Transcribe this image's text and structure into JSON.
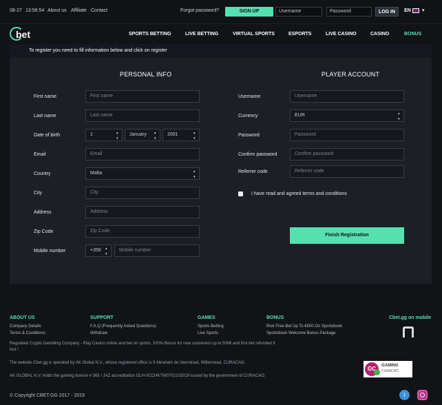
{
  "topbar": {
    "date": "08-27",
    "time": "13:56:54",
    "links": [
      "About us",
      "Affiliate",
      "Contact"
    ],
    "forgot": "Forgot password?",
    "signup": "SIGN UP",
    "username_ph": "Username",
    "password_ph": "Password",
    "login": "LOG IN",
    "lang": "EN"
  },
  "brand": {
    "logo_text": "bet"
  },
  "nav": [
    "SPORTS BETTING",
    "LIVE BETTING",
    "VIRTUAL SPORTS",
    "ESPORTS",
    "LIVE CASINO",
    "CASINO",
    "BONUS"
  ],
  "panel": {
    "notice": "To register you need to fill information below and click on register",
    "personal_title": "PERSONAL INFO",
    "account_title": "PLAYER ACCOUNT"
  },
  "personal": {
    "first_name": {
      "label": "First name",
      "placeholder": "First name"
    },
    "last_name": {
      "label": "Last name",
      "placeholder": "Last name"
    },
    "dob": {
      "label": "Date of birth",
      "day": "1",
      "month": "January",
      "year": "2001"
    },
    "email": {
      "label": "Email",
      "placeholder": "Email"
    },
    "country": {
      "label": "Country",
      "value": "Malta"
    },
    "city": {
      "label": "City",
      "placeholder": "City"
    },
    "address": {
      "label": "Address",
      "placeholder": "Address"
    },
    "zip": {
      "label": "Zip Code",
      "placeholder": "Zip Code"
    },
    "mobile": {
      "label": "Mobile number",
      "prefix": "+356",
      "placeholder": "Mobile number"
    }
  },
  "account": {
    "username": {
      "label": "Username",
      "placeholder": "Username"
    },
    "currency": {
      "label": "Currency",
      "value": "EUR"
    },
    "password": {
      "label": "Password",
      "placeholder": "Password"
    },
    "confirm": {
      "label": "Confirm password",
      "placeholder": "Confirm password"
    },
    "referrer": {
      "label": "Referrer code",
      "placeholder": "Referrer code"
    },
    "terms": "I have read and agreed terms and conditions",
    "finish": "Finish Registration"
  },
  "footer": {
    "about": {
      "title": "ABOUT US",
      "links": [
        "Company Details",
        "Terms & Conditions"
      ]
    },
    "support": {
      "title": "SUPPORT",
      "links": [
        "F.A.Q (Frequently Asked Questions)",
        "Withdraw"
      ]
    },
    "games": {
      "title": "GAMES",
      "links": [
        "Sports Betting",
        "Live Sports"
      ]
    },
    "bonus": {
      "title": "BONUS",
      "links": [
        "Risk Free Bet Up To €500 On Sportsbook",
        "Sportsbook Welcome Bonus Package"
      ]
    },
    "mobile": "Cbet.gg on mobile",
    "para1a": "Regulated Crypto Gambling Company - Play Casino online and bet on sports. 100% Bonus for new customers up to 500€ and first bet refunded if",
    "para1b": "lost !",
    "para2": "The website Cbet.gg is operated by AK Global N.V., whose registered office is 9 Abraham de Veerstraat, Willemstad, CURACAO.",
    "para3": "AK GLOBAL N.V. holds the gaming license # 365 / JAZ accreditation GLH-0CCHKTW0702102019 issued by the government of CURACAO.",
    "badge_t1": "GAMING",
    "badge_t2": "CURACAO",
    "copyright": "© Copyright CBET.GG 2017 - 2019"
  }
}
